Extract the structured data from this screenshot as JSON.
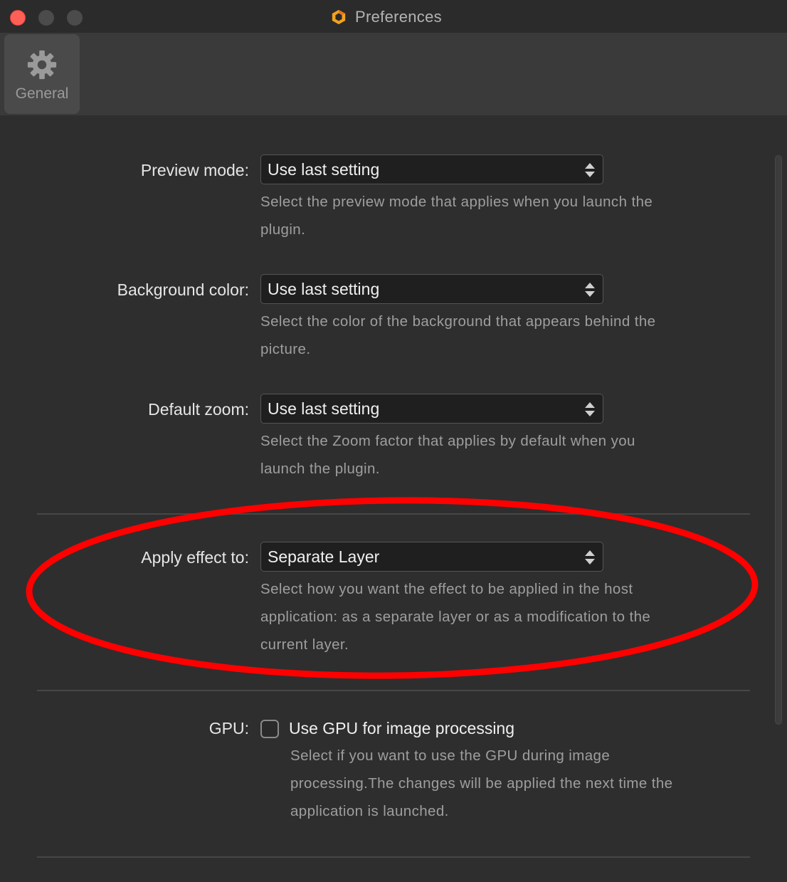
{
  "window": {
    "title": "Preferences",
    "app_icon": "hexagon-logo-icon",
    "traffic_lights": [
      "close",
      "minimize",
      "maximize"
    ],
    "close_color": "#fe5f57"
  },
  "toolbar": {
    "tabs": [
      {
        "label": "General",
        "icon": "gear-icon",
        "selected": true
      }
    ]
  },
  "settings": {
    "preview_mode": {
      "label": "Preview mode:",
      "value": "Use last setting",
      "description_line1": "Select the preview mode that applies when you launch the",
      "description_line2": "plugin."
    },
    "background_color": {
      "label": "Background color:",
      "value": "Use last setting",
      "description_line1": "Select the color of the background that appears behind the",
      "description_line2": "picture."
    },
    "default_zoom": {
      "label": "Default zoom:",
      "value": "Use last setting",
      "description_line1": "Select the Zoom factor that applies by default when you",
      "description_line2": "launch the plugin."
    },
    "apply_effect": {
      "label": "Apply effect to:",
      "value": "Separate Layer",
      "description_line1": "Select how you want the effect to be applied in the host",
      "description_line2": "application: as a separate layer or as a modification to the",
      "description_line3": "current layer.",
      "highlighted": true,
      "highlight_color": "#ff0000"
    },
    "gpu": {
      "label": "GPU:",
      "checkbox_label": "Use GPU for image processing",
      "checked": false,
      "description_line1": "Select if you want to use the GPU during image",
      "description_line2": "processing.The changes will be applied the next time the",
      "description_line3": "application is launched."
    }
  }
}
